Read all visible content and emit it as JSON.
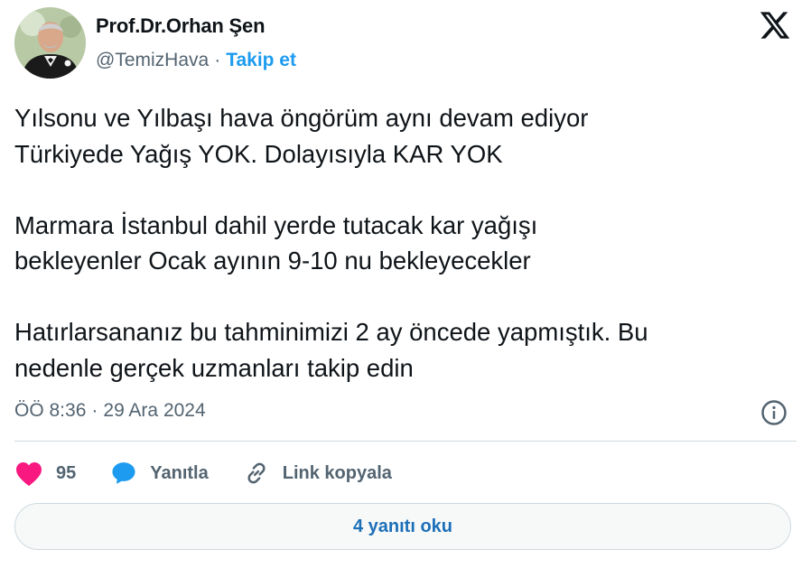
{
  "author": {
    "name": "Prof.Dr.Orhan Şen",
    "handle": "@TemizHava",
    "separator": "·",
    "follow_label": "Takip et"
  },
  "tweet": {
    "lines": [
      "Yılsonu ve Yılbaşı hava öngörüm aynı devam ediyor",
      "Türkiyede Yağış YOK. Dolayısıyla KAR YOK",
      "Marmara İstanbul dahil yerde tutacak kar yağışı",
      "bekleyenler Ocak ayının 9-10 nu bekleyecekler",
      "Hatırlarsananız bu tahminimizi 2 ay öncede yapmıştık. Bu",
      "nedenle gerçek uzmanları takip edin"
    ],
    "time": "ÖÖ 8:36",
    "separator": "·",
    "date": "29 Ara 2024"
  },
  "actions": {
    "likes_count": "95",
    "reply_label": "Yanıtla",
    "copy_link_label": "Link kopyala"
  },
  "replies_button_label": "4 yanıtı oku",
  "colors": {
    "accent": "#1d9bf0",
    "like": "#f91880",
    "text": "#0f1419",
    "muted": "#536471"
  },
  "icons": [
    "x-logo-icon",
    "info-icon",
    "heart-icon",
    "reply-bubble-icon",
    "link-icon"
  ]
}
